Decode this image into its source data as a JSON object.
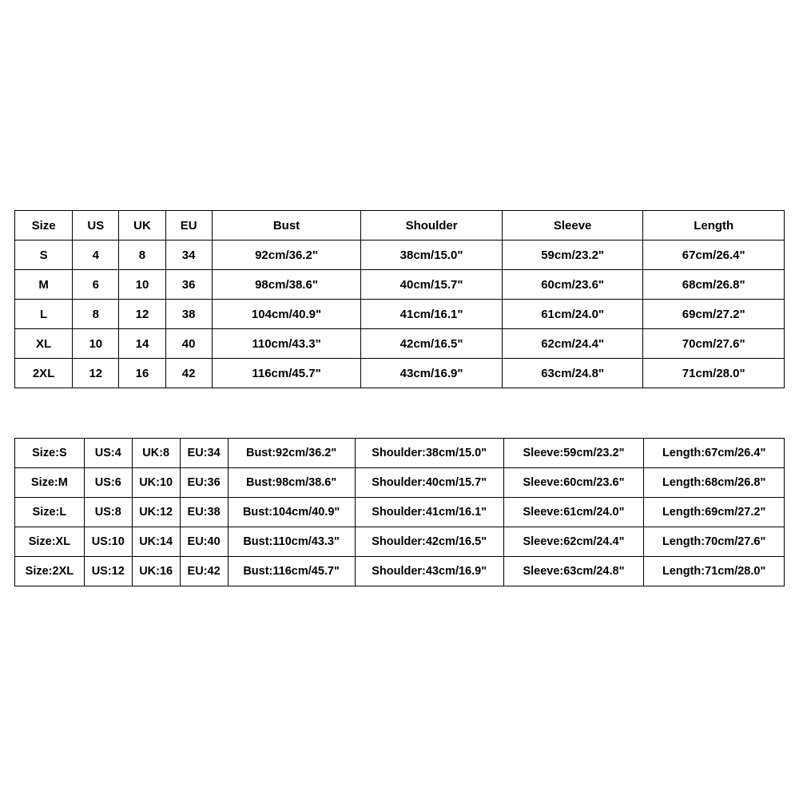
{
  "table1": {
    "headers": [
      "Size",
      "US",
      "UK",
      "EU",
      "Bust",
      "Shoulder",
      "Sleeve",
      "Length"
    ],
    "rows": [
      [
        "S",
        "4",
        "8",
        "34",
        "92cm/36.2\"",
        "38cm/15.0\"",
        "59cm/23.2\"",
        "67cm/26.4\""
      ],
      [
        "M",
        "6",
        "10",
        "36",
        "98cm/38.6\"",
        "40cm/15.7\"",
        "60cm/23.6\"",
        "68cm/26.8\""
      ],
      [
        "L",
        "8",
        "12",
        "38",
        "104cm/40.9\"",
        "41cm/16.1\"",
        "61cm/24.0\"",
        "69cm/27.2\""
      ],
      [
        "XL",
        "10",
        "14",
        "40",
        "110cm/43.3\"",
        "42cm/16.5\"",
        "62cm/24.4\"",
        "70cm/27.6\""
      ],
      [
        "2XL",
        "12",
        "16",
        "42",
        "116cm/45.7\"",
        "43cm/16.9\"",
        "63cm/24.8\"",
        "71cm/28.0\""
      ]
    ]
  },
  "table2": {
    "rows": [
      [
        "Size:S",
        "US:4",
        "UK:8",
        "EU:34",
        "Bust:92cm/36.2\"",
        "Shoulder:38cm/15.0\"",
        "Sleeve:59cm/23.2\"",
        "Length:67cm/26.4\""
      ],
      [
        "Size:M",
        "US:6",
        "UK:10",
        "EU:36",
        "Bust:98cm/38.6\"",
        "Shoulder:40cm/15.7\"",
        "Sleeve:60cm/23.6\"",
        "Length:68cm/26.8\""
      ],
      [
        "Size:L",
        "US:8",
        "UK:12",
        "EU:38",
        "Bust:104cm/40.9\"",
        "Shoulder:41cm/16.1\"",
        "Sleeve:61cm/24.0\"",
        "Length:69cm/27.2\""
      ],
      [
        "Size:XL",
        "US:10",
        "UK:14",
        "EU:40",
        "Bust:110cm/43.3\"",
        "Shoulder:42cm/16.5\"",
        "Sleeve:62cm/24.4\"",
        "Length:70cm/27.6\""
      ],
      [
        "Size:2XL",
        "US:12",
        "UK:16",
        "EU:42",
        "Bust:116cm/45.7\"",
        "Shoulder:43cm/16.9\"",
        "Sleeve:63cm/24.8\"",
        "Length:71cm/28.0\""
      ]
    ]
  }
}
